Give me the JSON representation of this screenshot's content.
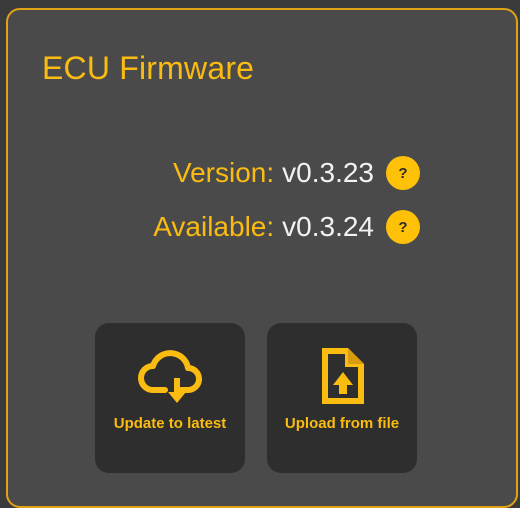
{
  "panel": {
    "title": "ECU Firmware",
    "version_label": "Version:",
    "version_value": "v0.3.23",
    "available_label": "Available:",
    "available_value": "v0.3.24",
    "help_glyph": "?"
  },
  "actions": [
    {
      "label": "Update to latest",
      "icon": "cloud-download-icon"
    },
    {
      "label": "Upload from file",
      "icon": "file-upload-icon"
    }
  ],
  "colors": {
    "accent": "#fbbc11",
    "help_badge": "#ffc107",
    "panel_bg": "#4a4a4a",
    "page_bg": "#3b3b3b",
    "button_bg": "#2e2e2e",
    "value_text": "#f2f2f2"
  }
}
